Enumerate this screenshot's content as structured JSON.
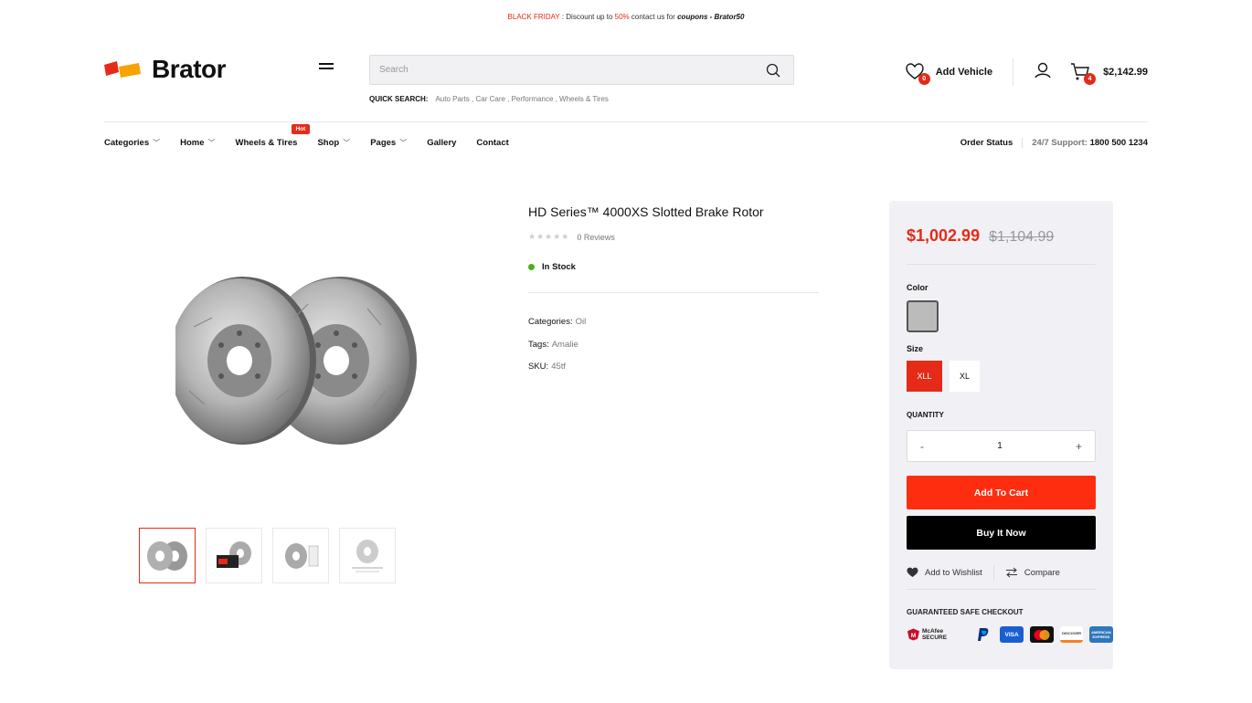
{
  "topbar": {
    "label": "BLACK FRIDAY",
    "sep": " : Discount up to ",
    "percent": "50%",
    "mid": " contact us for ",
    "coupon": "coupons - Brator50"
  },
  "header": {
    "brand": "Brator",
    "search_placeholder": "Search",
    "quick_label": "QUICK SEARCH:",
    "quick_links": "Auto Parts , Car Care , Performance , Wheels & Tires",
    "vehicle_count": "0",
    "vehicle_label": "Add Vehicle",
    "cart_count": "4",
    "cart_total": "$2,142.99"
  },
  "nav": {
    "items": [
      {
        "label": "Categories"
      },
      {
        "label": "Home"
      },
      {
        "label": "Wheels & Tires"
      },
      {
        "label": "Shop"
      },
      {
        "label": "Pages"
      },
      {
        "label": "Gallery"
      },
      {
        "label": "Contact"
      }
    ],
    "hot_badge": "Hot",
    "order_status": "Order Status",
    "support_label": "24/7 Support: ",
    "support_phone": "1800 500 1234"
  },
  "product": {
    "title": "HD Series™ 4000XS Slotted Brake Rotor",
    "stars": "★★★★★",
    "reviews": "0 Reviews",
    "stock": "In Stock",
    "categories_label": "Categories:",
    "categories_value": "Oil",
    "tags_label": "Tags:",
    "tags_value": "Amalie",
    "sku_label": "SKU:",
    "sku_value": "45tf"
  },
  "purchase": {
    "price_now": "$1,002.99",
    "price_old": "$1,104.99",
    "color_label": "Color",
    "size_label": "Size",
    "sizes": [
      "XLL",
      "XL"
    ],
    "quantity_label": "QUANTITY",
    "qty_minus": "-",
    "qty_value": "1",
    "qty_plus": "+",
    "add_to_cart": "Add To Cart",
    "buy_now": "Buy It Now",
    "wishlist": "Add to Wishlist",
    "compare": "Compare",
    "safe_checkout": "GUARANTEED SAFE CHECKOUT",
    "payment": [
      "McAfee SECURE",
      "PayPal",
      "VISA",
      "mastercard",
      "DISCOVER",
      "AMERICAN EXPRESS"
    ]
  },
  "colors": {
    "accent": "#e52a18",
    "in_stock": "#4caf1a",
    "panel_bg": "#f1f1f5"
  }
}
